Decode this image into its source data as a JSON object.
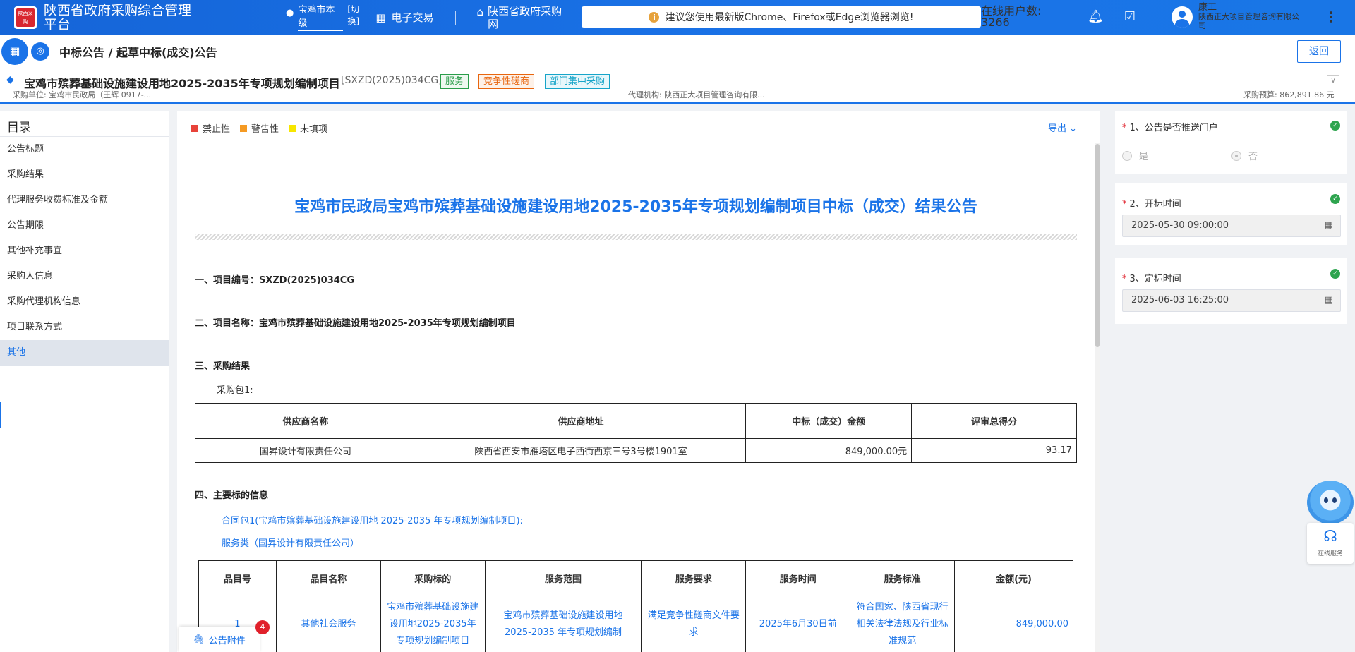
{
  "header": {
    "logo_text": "陕西采购",
    "app_title": "陕西省政府采购综合管理平台",
    "region": "宝鸡市本级",
    "region_switch": "[切换]",
    "nav_trade": "电子交易",
    "nav_portal": "陕西省政府采购网",
    "browser_notice": "建议您使用最新版Chrome、Firefox或Edge浏览器浏览!",
    "online_users": "在线用户数: 3266",
    "user_name": "康工",
    "user_org": "陕西正大项目管理咨询有限公司"
  },
  "breadcrumb": {
    "text": "中标公告 / 起草中标(成交)公告",
    "back_label": "返回"
  },
  "project": {
    "name": "宝鸡市殡葬基础设施建设用地2025-2035年专项规划编制项目",
    "code": "[SXZD(2025)034CG]",
    "tags": [
      "服务",
      "竞争性磋商",
      "部门集中采购"
    ],
    "purchaser": "采购单位: 宝鸡市民政局（王辉 0917-...",
    "agency": "代理机构: 陕西正大项目管理咨询有限...",
    "budget": "采购预算: 862,891.86 元"
  },
  "toc": {
    "title": "目录",
    "items": [
      "公告标题",
      "采购结果",
      "代理服务收费标准及金额",
      "公告期限",
      "其他补充事宜",
      "采购人信息",
      "采购代理机构信息",
      "项目联系方式",
      "其他"
    ],
    "active_index": 8
  },
  "legend": {
    "items": [
      {
        "label": "禁止性",
        "color": "#e8433a"
      },
      {
        "label": "警告性",
        "color": "#f59a23"
      },
      {
        "label": "未填项",
        "color": "#f7e600"
      }
    ],
    "export_label": "导出"
  },
  "document": {
    "title": "宝鸡市民政局宝鸡市殡葬基础设施建设用地2025-2035年专项规划编制项目中标（成交）结果公告",
    "s1": "一、项目编号：SXZD(2025)034CG",
    "s2": "二、项目名称：宝鸡市殡葬基础设施建设用地2025-2035年专项规划编制项目",
    "s3": "三、采购结果",
    "pkg": "采购包1:",
    "result_table": {
      "headers": [
        "供应商名称",
        "供应商地址",
        "中标（成交）金额",
        "评审总得分"
      ],
      "rows": [
        [
          "国昇设计有限责任公司",
          "陕西省西安市雁塔区电子西街西京三号3号楼1901室",
          "849,000.00元",
          "93.17"
        ]
      ]
    },
    "s4": "四、主要标的信息",
    "contract_pkg": "合同包1(宝鸡市殡葬基础设施建设用地 2025-2035 年专项规划编制项目):",
    "service_class": "服务类（国昇设计有限责任公司）",
    "item_table": {
      "headers": [
        "品目号",
        "品目名称",
        "采购标的",
        "服务范围",
        "服务要求",
        "服务时间",
        "服务标准",
        "金额(元)"
      ],
      "rows": [
        [
          "1",
          "其他社会服务",
          "宝鸡市殡葬基础设施建设用地2025-2035年专项规划编制项目",
          "宝鸡市殡葬基础设施建设用地 2025-2035 年专项规划编制",
          "满足竞争性磋商文件要求",
          "2025年6月30日前",
          "符合国家、陕西省现行相关法律法规及行业标准规范",
          "849,000.00"
        ]
      ]
    }
  },
  "attachment": {
    "label": "公告附件",
    "count": "4"
  },
  "right_panel": {
    "q1_label": "1、公告是否推送门户",
    "q1_options": [
      "是",
      "否"
    ],
    "q2_label": "2、开标时间",
    "q2_value": "2025-05-30 09:00:00",
    "q3_label": "3、定标时间",
    "q3_value": "2025-06-03 16:25:00"
  },
  "service": {
    "label": "在线服务"
  }
}
